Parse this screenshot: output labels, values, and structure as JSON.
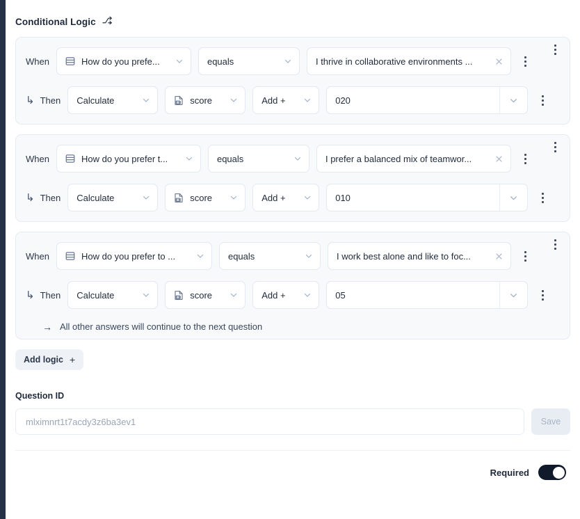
{
  "section": {
    "title": "Conditional Logic",
    "icon": "split-branch-icon"
  },
  "labels": {
    "when": "When",
    "then": "Then"
  },
  "rules": [
    {
      "question": "How do you prefe...",
      "question_icon": "rows-list-icon",
      "operator": "equals",
      "answer": "I thrive in collaborative environments ...",
      "action": "Calculate",
      "variable": "score",
      "variable_icon": "number-file-icon",
      "operation": "Add +",
      "value": "020",
      "question_width": 194,
      "operator_width": 146,
      "answer_width": 294
    },
    {
      "question": "How do you prefer t...",
      "question_icon": "rows-list-icon",
      "operator": "equals",
      "answer": "I prefer a balanced mix of teamwor...",
      "action": "Calculate",
      "variable": "score",
      "variable_icon": "number-file-icon",
      "operation": "Add +",
      "value": "010",
      "question_width": 208,
      "operator_width": 146,
      "answer_width": 280
    },
    {
      "question": "How do you prefer to ...",
      "question_icon": "rows-list-icon",
      "operator": "equals",
      "answer": "I work best alone and like to foc...",
      "action": "Calculate",
      "variable": "score",
      "variable_icon": "number-file-icon",
      "operation": "Add +",
      "value": "05",
      "question_width": 224,
      "operator_width": 146,
      "answer_width": 264
    }
  ],
  "fallback": {
    "text": "All other answers will continue to the next question",
    "icon": "arrow-right-icon"
  },
  "add_logic": {
    "label": "Add logic",
    "icon": "plus-icon"
  },
  "question_id": {
    "label": "Question ID",
    "placeholder": "mlximnrt1t7acdy3z6ba3ev1",
    "value": "",
    "save_label": "Save",
    "save_disabled": true
  },
  "required": {
    "label": "Required",
    "enabled": true
  },
  "colors": {
    "rail": "#243147",
    "card_bg": "#f7f9fb",
    "card_border": "#e6ebf1",
    "field_bg": "#ffffff",
    "field_border": "#e3e9f0",
    "text": "#1f2a3a",
    "muted": "#9aa6b7",
    "toggle_on": "#111a2b",
    "add_logic_bg": "#eef2f7"
  }
}
